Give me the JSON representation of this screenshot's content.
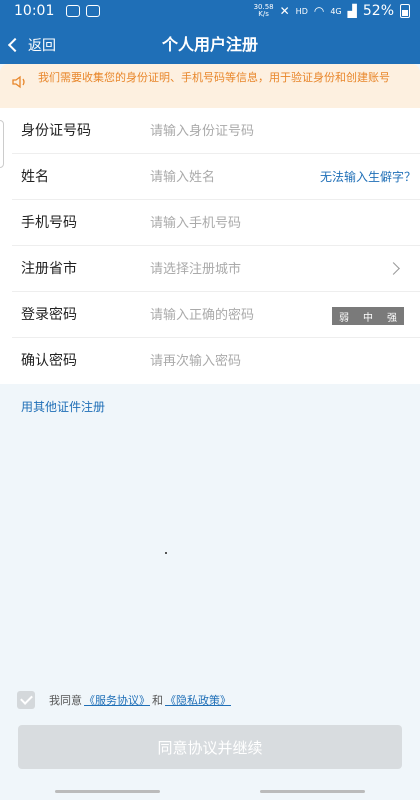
{
  "status_bar": {
    "time": "10:01",
    "speed_value": "30.58",
    "speed_unit": "K/s",
    "hd": "HD",
    "network": "4G",
    "battery": "52%"
  },
  "nav": {
    "back_label": "返回",
    "title": "个人用户注册"
  },
  "notice": {
    "text": "我们需要收集您的身份证明、手机号码等信息，用于验证身份和创建账号",
    "color": "#e8862a"
  },
  "form": {
    "rows": [
      {
        "label": "身份证号码",
        "placeholder": "请输入身份证号码"
      },
      {
        "label": "姓名",
        "placeholder": "请输入姓名",
        "link": "无法输入生僻字？"
      },
      {
        "label": "手机号码",
        "placeholder": "请输入手机号码"
      },
      {
        "label": "注册省市",
        "placeholder": "请选择注册城市"
      },
      {
        "label": "登录密码",
        "placeholder": "请输入正确的密码",
        "strength": [
          "弱",
          "中",
          "强"
        ]
      },
      {
        "label": "确认密码",
        "placeholder": "请再次输入密码"
      }
    ]
  },
  "other_register": "用其他证件注册",
  "agreement": {
    "prefix": "我同意",
    "service": "《服务协议》",
    "and": "和",
    "privacy": "《隐私政策》"
  },
  "continue_label": "同意协议并继续",
  "colors": {
    "primary": "#1f6fb7",
    "background": "#f0f6fa",
    "button_disabled": "#d8dcdf",
    "strength_bar": "#7a7a7a"
  }
}
